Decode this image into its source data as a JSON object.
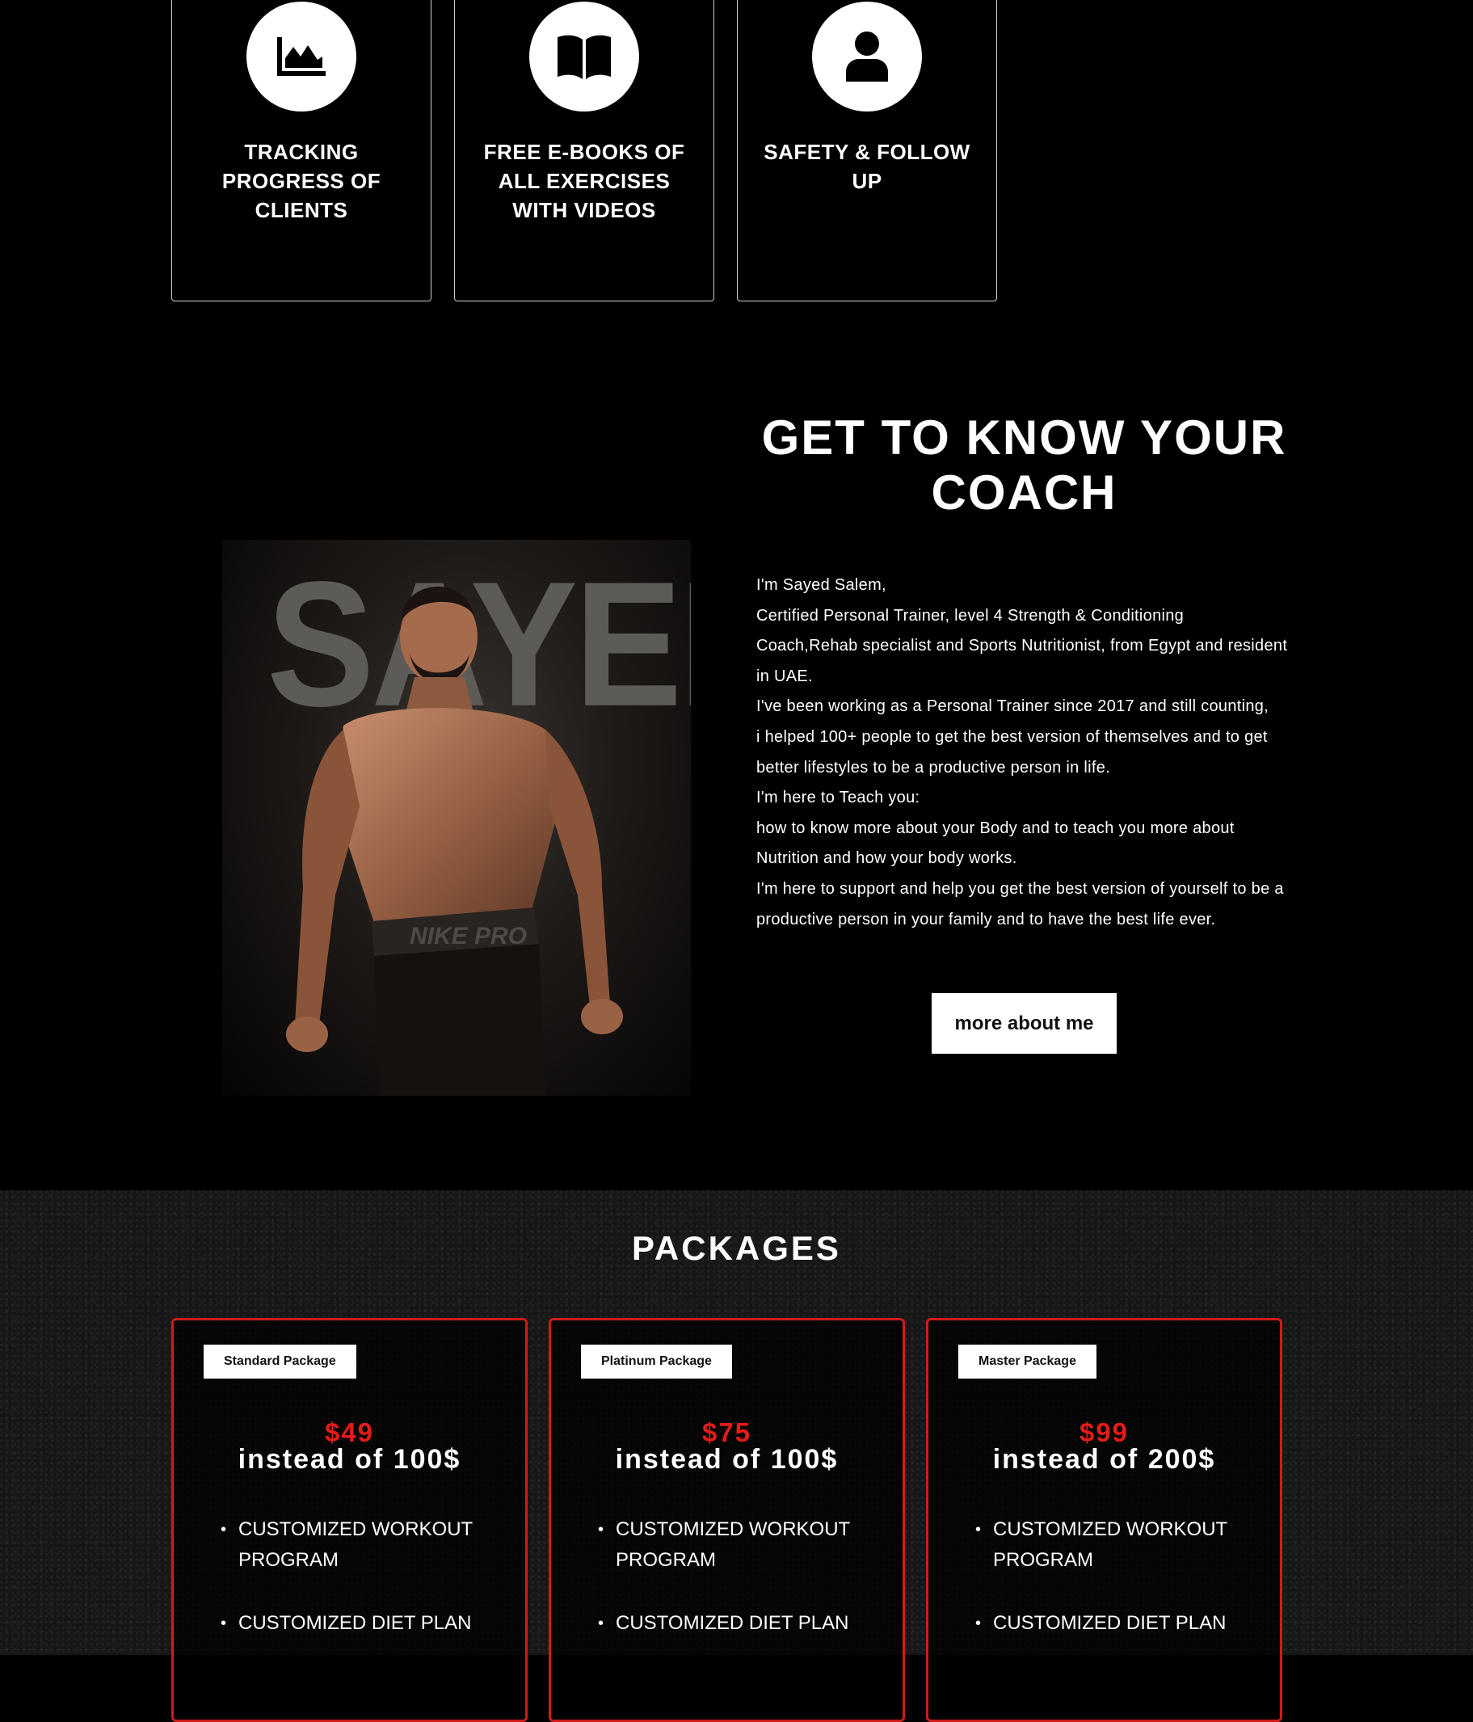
{
  "features": [
    {
      "icon": "chart-area-icon",
      "title": "TRACKING PROGRESS OF CLIENTS"
    },
    {
      "icon": "book-open-icon",
      "title": "FREE E-BOOKS OF ALL EXERCISES WITH VIDEOS"
    },
    {
      "icon": "user-icon",
      "title": "SAFETY & FOLLOW UP"
    }
  ],
  "coach": {
    "heading": "GET TO KNOW YOUR COACH",
    "photo_watermark": "SAYED",
    "bio": [
      "I'm Sayed Salem,",
      "Certified Personal Trainer, level 4 Strength & Conditioning Coach,Rehab specialist and Sports Nutritionist, from Egypt and resident in UAE.",
      "I've been working as a Personal Trainer since 2017 and still counting,",
      "i helped 100+ people to get the best version of themselves and to get better lifestyles to be a productive person in life.",
      "I'm here to Teach you:",
      "how to know more about your Body and to teach you more about Nutrition and how your body works.",
      "I'm here to support and help you get the best version of yourself to be a productive person in your family and to have the best life ever."
    ],
    "button_label": "more about me"
  },
  "packages": {
    "title": "PACKAGES",
    "accent_color": "#d11a1a",
    "items": [
      {
        "tag": "Standard Package",
        "price": "$49",
        "instead": "instead of 100$",
        "features": [
          "CUSTOMIZED WORKOUT PROGRAM",
          "CUSTOMIZED DIET PLAN"
        ]
      },
      {
        "tag": "Platinum Package",
        "price": "$75",
        "instead": "instead of 100$",
        "features": [
          "CUSTOMIZED WORKOUT PROGRAM",
          "CUSTOMIZED DIET PLAN"
        ]
      },
      {
        "tag": "Master Package",
        "price": "$99",
        "instead": "instead of 200$",
        "features": [
          "CUSTOMIZED WORKOUT PROGRAM",
          "CUSTOMIZED DIET PLAN"
        ]
      }
    ]
  }
}
